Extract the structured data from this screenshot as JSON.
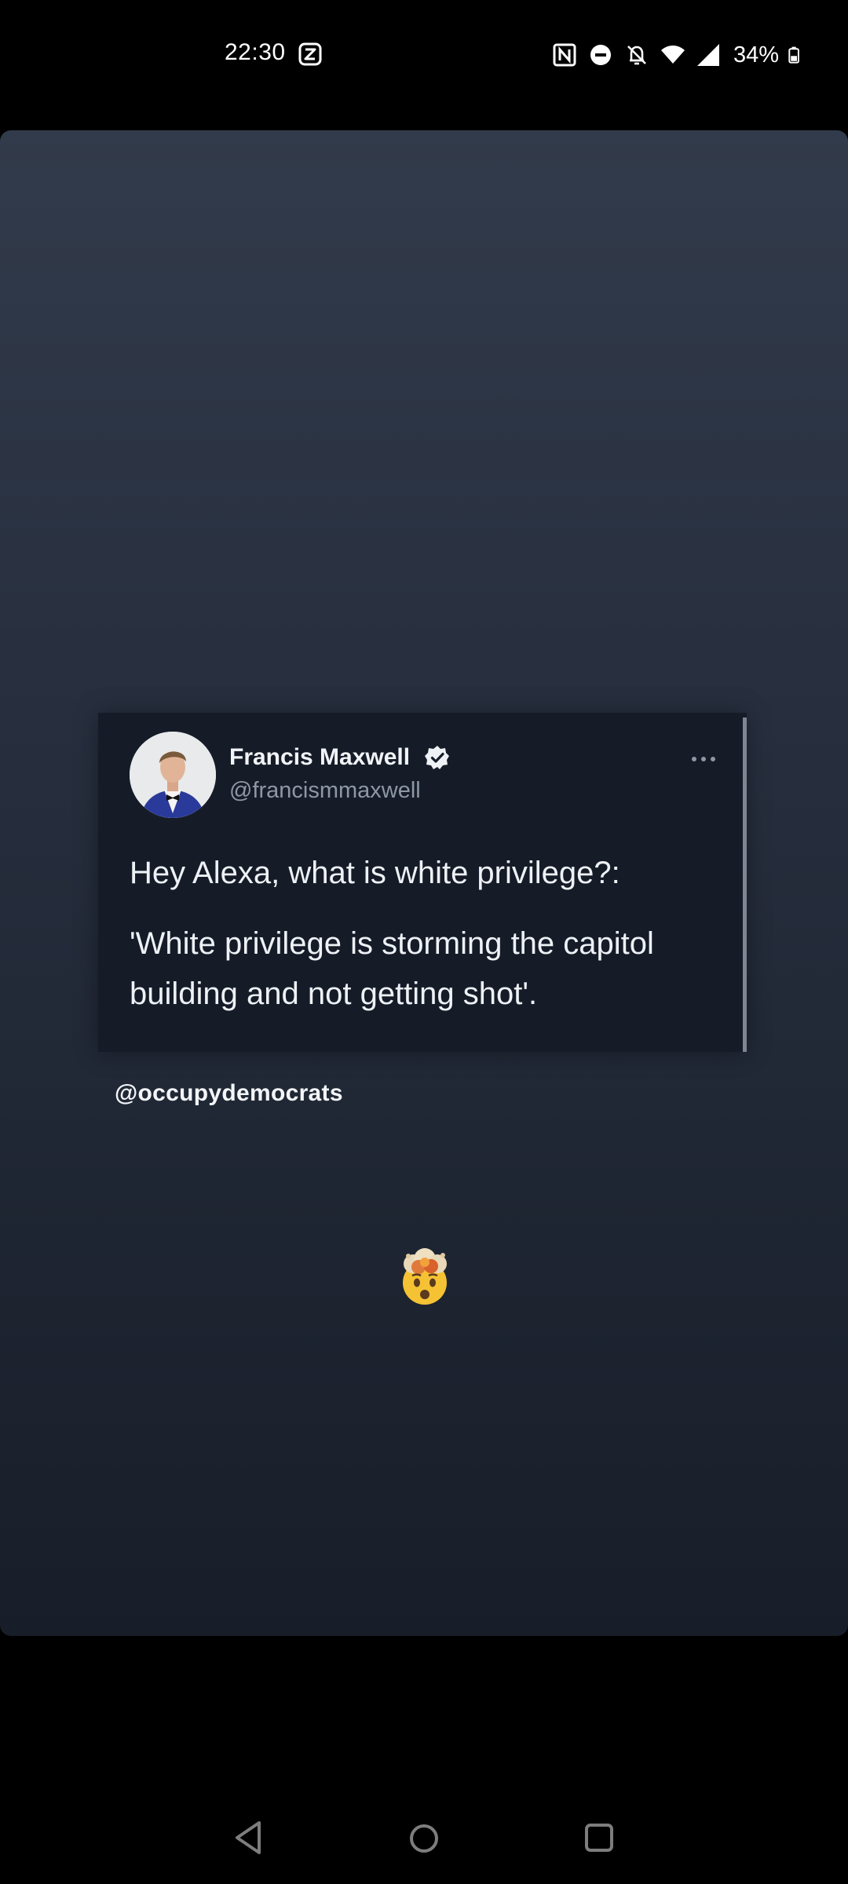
{
  "status_bar": {
    "time": "22:30",
    "battery_percent": "34%",
    "left_icons": [
      "z-app-icon"
    ],
    "right_icons": [
      "nfc-icon",
      "do-not-disturb-icon",
      "notifications-off-icon",
      "wifi-icon",
      "signal-icon",
      "battery-icon"
    ]
  },
  "tweet": {
    "author_name": "Francis Maxwell",
    "author_handle": "@francismmaxwell",
    "verified": true,
    "text_line1": "Hey Alexa, what is white privilege?:",
    "text_line2": "'White privilege is storming the capitol building and not getting shot'."
  },
  "caption": "@occupydemocrats",
  "sticker": "exploding-head-emoji",
  "nav_bar": {
    "buttons": [
      "back",
      "home",
      "recents"
    ]
  },
  "colors": {
    "background": "#000000",
    "story_gradient_top": "#323b4b",
    "story_gradient_bottom": "#181e29",
    "tweet_background": "#151c28",
    "handle_gray": "#8e97a4"
  }
}
